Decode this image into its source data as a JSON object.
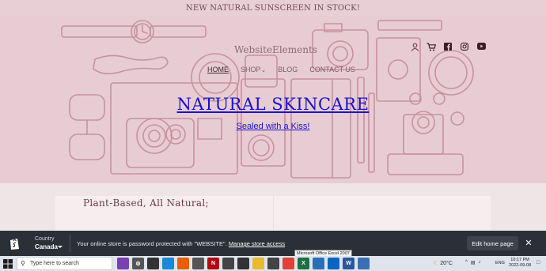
{
  "announcement": {
    "text": "NEW NATURAL SUNSCREEN IN STOCK!"
  },
  "header": {
    "brand": "WebsiteElements",
    "icons": [
      "user-icon",
      "cart-icon",
      "facebook-icon",
      "instagram-icon",
      "youtube-icon"
    ],
    "nav": [
      "HOME",
      "SHOP",
      "BLOG",
      "CONTACT US"
    ],
    "shop_caret": "⌄"
  },
  "hero": {
    "title": "NATURAL SKINCARE",
    "subtitle": "Sealed with a Kiss!"
  },
  "content": {
    "heading": "Plant-Based, All Natural;"
  },
  "password_bar": {
    "country_label": "Country",
    "country_value": "Canada",
    "message": "Your online store is password protected with \"WEBSITE\".",
    "manage_link": "Manage store access",
    "edit_button": "Edit home page",
    "close": "✕"
  },
  "taskbar": {
    "search_placeholder": "Type here to search",
    "tooltip": "Microsoft Office Excel 2007",
    "weather": "20°C",
    "language": "ENG",
    "time": "10:17 PM",
    "date": "2022-09-08",
    "apps": [
      {
        "name": "people-app-icon",
        "color": "#7a3fb0",
        "glyph": ""
      },
      {
        "name": "settings-app-icon",
        "color": "#555555",
        "glyph": "⚙"
      },
      {
        "name": "task-view-icon",
        "color": "#333333",
        "glyph": ""
      },
      {
        "name": "edge-icon",
        "color": "#1a8ad4",
        "glyph": ""
      },
      {
        "name": "firefox-icon",
        "color": "#e66000",
        "glyph": ""
      },
      {
        "name": "store-icon",
        "color": "#555555",
        "glyph": ""
      },
      {
        "name": "netflix-icon",
        "color": "#b00710",
        "glyph": "N"
      },
      {
        "name": "game-icon",
        "color": "#444444",
        "glyph": ""
      },
      {
        "name": "photos-icon",
        "color": "#333333",
        "glyph": ""
      },
      {
        "name": "file-explorer-icon",
        "color": "#e8b931",
        "glyph": ""
      },
      {
        "name": "media-icon",
        "color": "#444444",
        "glyph": ""
      },
      {
        "name": "chrome-icon",
        "color": "#db4437",
        "glyph": ""
      },
      {
        "name": "excel-icon",
        "color": "#1d7044",
        "glyph": "X"
      },
      {
        "name": "remote-desktop-icon",
        "color": "#2a6fb6",
        "glyph": ""
      },
      {
        "name": "outlook-icon",
        "color": "#0a64c2",
        "glyph": ""
      },
      {
        "name": "word-icon",
        "color": "#2b579a",
        "glyph": "W"
      },
      {
        "name": "remote-icon",
        "color": "#3a6fb6",
        "glyph": ""
      }
    ]
  },
  "colors": {
    "hero_bg": "#e7ccd3",
    "line_art": "#c9919f",
    "link_blue": "#1a12c9",
    "password_bar_bg": "#2b3036"
  }
}
